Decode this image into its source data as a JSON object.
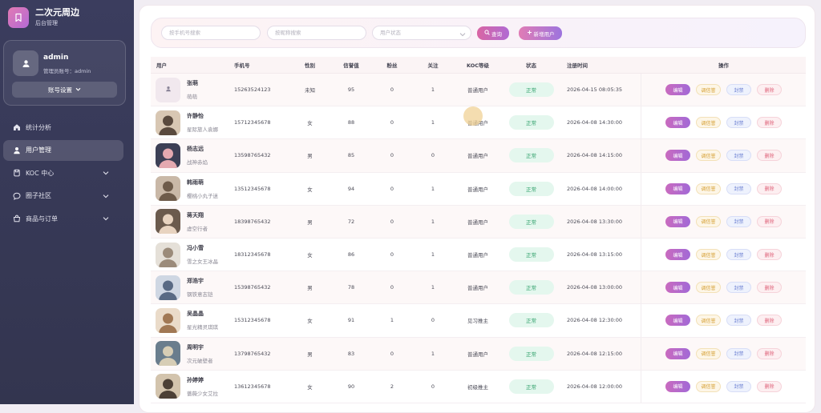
{
  "brand": {
    "title": "二次元周边",
    "subtitle": "后台管理"
  },
  "admin": {
    "name": "admin",
    "account": "管理员账号：admin",
    "settings_label": "账号设置"
  },
  "nav": [
    {
      "label": "统计分析",
      "icon": "home-icon",
      "active": false,
      "expandable": false
    },
    {
      "label": "用户管理",
      "icon": "user-icon",
      "active": true,
      "expandable": false
    },
    {
      "label": "KOC 中心",
      "icon": "badge-icon",
      "active": false,
      "expandable": true
    },
    {
      "label": "圈子社区",
      "icon": "chat-icon",
      "active": false,
      "expandable": true
    },
    {
      "label": "商品与订单",
      "icon": "shop-icon",
      "active": false,
      "expandable": true
    }
  ],
  "filters": {
    "phone_placeholder": "按手机号搜索",
    "nickname_placeholder": "按昵称搜索",
    "status_placeholder": "用户状态",
    "query_label": "查询",
    "add_label": "新增用户"
  },
  "columns": [
    "用户",
    "手机号",
    "性别",
    "信誉值",
    "粉丝",
    "关注",
    "KOC等级",
    "状态",
    "注册时间",
    "操作"
  ],
  "actions": {
    "edit": "编辑",
    "credit": "调信誉",
    "ban": "封禁",
    "delete": "删除"
  },
  "users": [
    {
      "name": "张萌",
      "nickname": "萌萌",
      "phone": "15263524123",
      "gender": "未知",
      "credit": "95",
      "fans": "0",
      "follow": "1",
      "koc": "普通用户",
      "status": "正常",
      "registered": "2026-04-15 08:05:35",
      "avatar": "default"
    },
    {
      "name": "许静怡",
      "nickname": "星际旅人袁娜",
      "phone": "15712345678",
      "gender": "女",
      "credit": "88",
      "fans": "0",
      "follow": "1",
      "koc": "普通用户",
      "status": "正常",
      "registered": "2026-04-08 14:30:00",
      "avatar": "photo"
    },
    {
      "name": "杨志远",
      "nickname": "战神赤焰",
      "phone": "13598765432",
      "gender": "男",
      "credit": "85",
      "fans": "0",
      "follow": "0",
      "koc": "普通用户",
      "status": "正常",
      "registered": "2026-04-08 14:15:00",
      "avatar": "photo"
    },
    {
      "name": "韩雨萌",
      "nickname": "樱桃小丸子迷",
      "phone": "13512345678",
      "gender": "女",
      "credit": "94",
      "fans": "0",
      "follow": "1",
      "koc": "普通用户",
      "status": "正常",
      "registered": "2026-04-08 14:00:00",
      "avatar": "photo"
    },
    {
      "name": "蒋天翔",
      "nickname": "虚空行者",
      "phone": "18398765432",
      "gender": "男",
      "credit": "72",
      "fans": "0",
      "follow": "1",
      "koc": "普通用户",
      "status": "正常",
      "registered": "2026-04-08 13:30:00",
      "avatar": "photo"
    },
    {
      "name": "冯小雪",
      "nickname": "雪之女王冰晶",
      "phone": "18312345678",
      "gender": "女",
      "credit": "86",
      "fans": "0",
      "follow": "1",
      "koc": "普通用户",
      "status": "正常",
      "registered": "2026-04-08 13:15:00",
      "avatar": "photo"
    },
    {
      "name": "郑浩宇",
      "nickname": "钢铁意志铠",
      "phone": "15398765432",
      "gender": "男",
      "credit": "78",
      "fans": "0",
      "follow": "1",
      "koc": "普通用户",
      "status": "正常",
      "registered": "2026-04-08 13:00:00",
      "avatar": "photo"
    },
    {
      "name": "吴晶晶",
      "nickname": "星光精灵琪琪",
      "phone": "15312345678",
      "gender": "女",
      "credit": "91",
      "fans": "1",
      "follow": "0",
      "koc": "见习推主",
      "status": "正常",
      "registered": "2026-04-08 12:30:00",
      "avatar": "photo"
    },
    {
      "name": "周明宇",
      "nickname": "次元破壁者",
      "phone": "13798765432",
      "gender": "男",
      "credit": "83",
      "fans": "0",
      "follow": "1",
      "koc": "普通用户",
      "status": "正常",
      "registered": "2026-04-08 12:15:00",
      "avatar": "photo"
    },
    {
      "name": "孙婷婷",
      "nickname": "蔷薇少女艾拉",
      "phone": "13612345678",
      "gender": "女",
      "credit": "90",
      "fans": "2",
      "follow": "0",
      "koc": "初级推主",
      "status": "正常",
      "registered": "2026-04-08 12:00:00",
      "avatar": "photo"
    }
  ],
  "colors": {
    "sidebar": "#3b3d5e",
    "accent_pink": "#d965a3",
    "accent_purple": "#a269d6",
    "status_green": "#2ea06a"
  }
}
